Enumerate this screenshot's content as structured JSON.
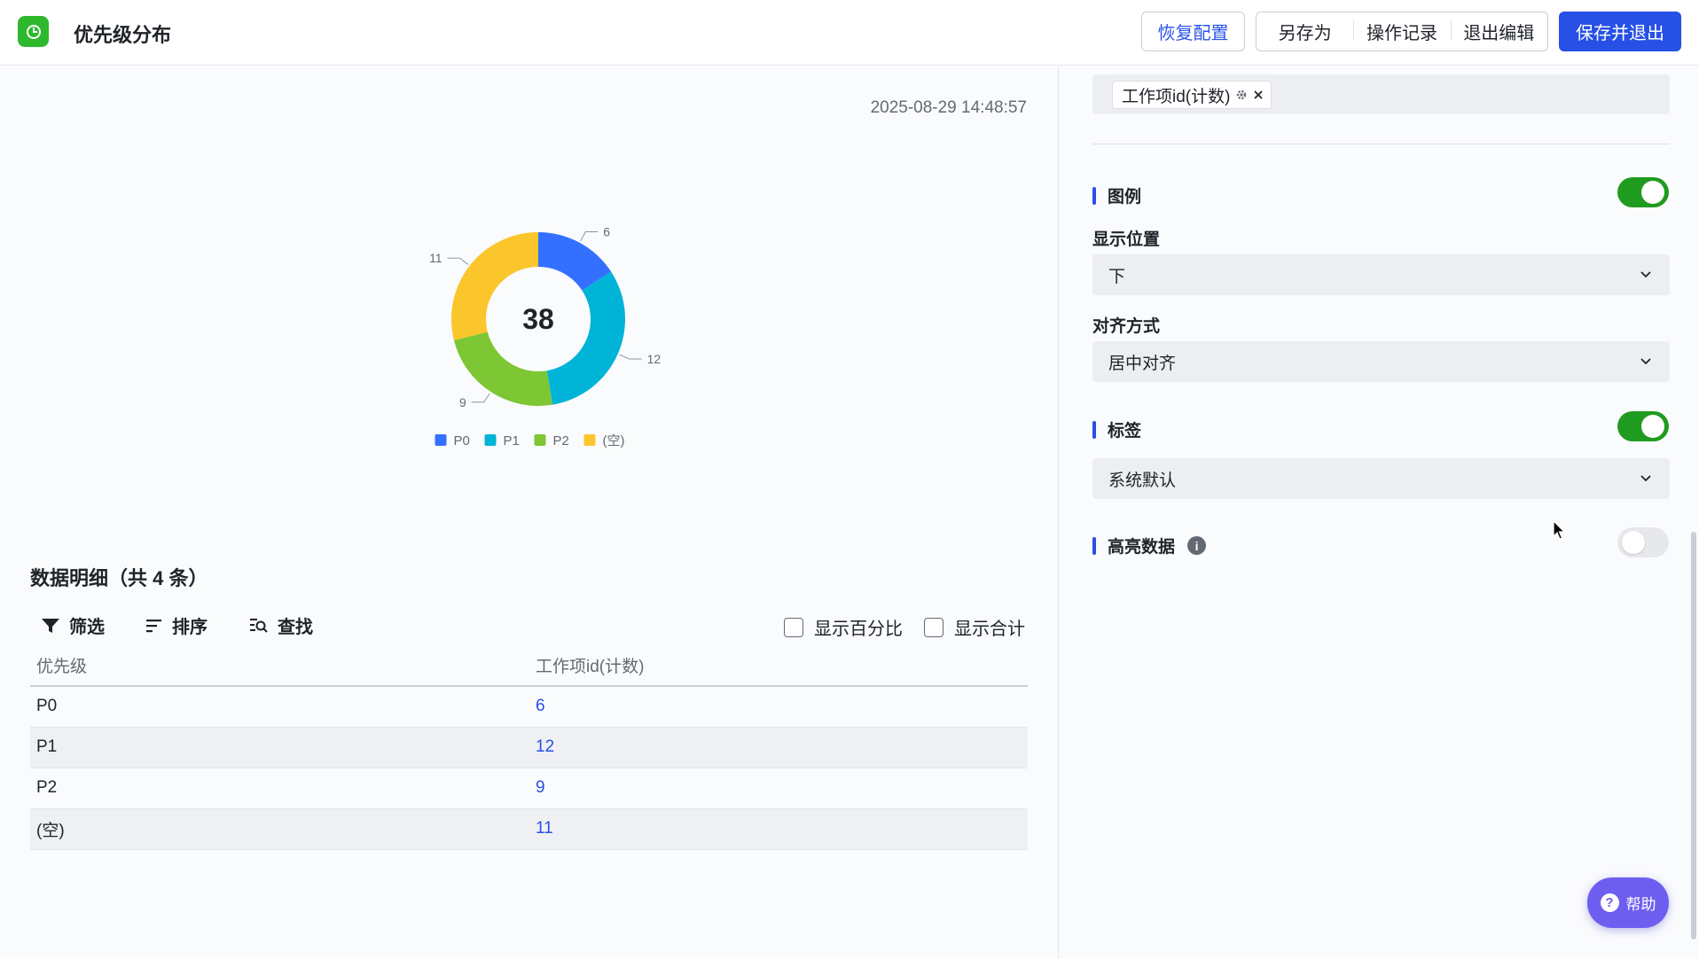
{
  "header": {
    "title": "优先级分布",
    "buttons": {
      "restore": "恢复配置",
      "save_as": "另存为",
      "history": "操作记录",
      "exit_edit": "退出编辑",
      "save_exit": "保存并退出"
    }
  },
  "colors": {
    "accent": "#2750e6",
    "brand": "#2eb82e",
    "toggle_on": "#1f9b1f"
  },
  "report": {
    "timestamp": "2025-08-29 14:48:57",
    "section_title": "数据明细（共 4 条）",
    "toolbar": {
      "filter": "筛选",
      "sort": "排序",
      "search": "查找"
    },
    "options": {
      "show_percent": "显示百分比",
      "show_total": "显示合计"
    },
    "table": {
      "columns": [
        "优先级",
        "工作项id(计数)"
      ],
      "rows": [
        {
          "priority": "P0",
          "count": "6"
        },
        {
          "priority": "P1",
          "count": "12"
        },
        {
          "priority": "P2",
          "count": "9"
        },
        {
          "priority": "(空)",
          "count": "11"
        }
      ]
    }
  },
  "chart_data": {
    "type": "pie",
    "variant": "donut",
    "center_label": "38",
    "categories": [
      "P0",
      "P1",
      "P2",
      "(空)"
    ],
    "values": [
      6,
      12,
      9,
      11
    ],
    "colors": [
      "#3370ff",
      "#00b4d8",
      "#7dc634",
      "#fbc52c"
    ],
    "legend_position": "bottom",
    "data_labels": true
  },
  "settings": {
    "metric_tag": "工作项id(计数)",
    "legend": {
      "title": "图例",
      "enabled": true,
      "position_label": "显示位置",
      "position_value": "下",
      "align_label": "对齐方式",
      "align_value": "居中对齐"
    },
    "labels": {
      "title": "标签",
      "enabled": true,
      "value": "系统默认"
    },
    "highlight": {
      "title": "高亮数据",
      "enabled": false
    }
  },
  "help": {
    "label": "帮助"
  }
}
